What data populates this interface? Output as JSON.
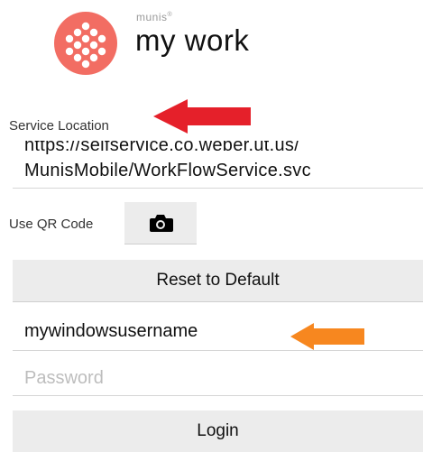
{
  "header": {
    "brand_small": "munis",
    "brand_trademark": "®",
    "app_title": "my work",
    "logo_color": "#f26d63"
  },
  "service": {
    "label": "Service Location",
    "url_line1": "https://selfservice.co.weber.ut.us/",
    "url_line2": "MunisMobile/WorkFlowService.svc"
  },
  "qr": {
    "label": "Use QR Code",
    "icon": "camera-icon"
  },
  "buttons": {
    "reset": "Reset to Default",
    "login": "Login"
  },
  "login_form": {
    "username_value": "mywindowsusername",
    "password_placeholder": "Password"
  },
  "annotations": {
    "red_arrow_color": "#e5202a",
    "orange_arrow_color": "#f7871f"
  }
}
